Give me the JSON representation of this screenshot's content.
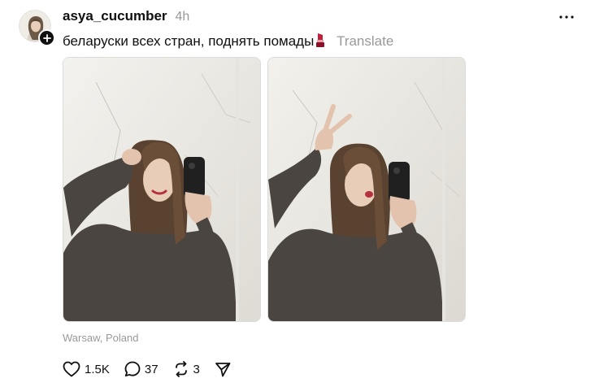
{
  "post": {
    "username": "asya_cucumber",
    "time": "4h",
    "caption": "беларуски всех стран, поднять помады",
    "translate_label": "Translate",
    "location": "Warsaw, Poland",
    "photos": [
      {
        "icon": "photo-selfie-hand-in-hair"
      },
      {
        "icon": "photo-selfie-peace-sign"
      }
    ]
  },
  "actions": {
    "likes": "1.5K",
    "replies": "37",
    "reposts": "3"
  },
  "icons": {
    "follow": "plus-icon",
    "more": "more-dots-icon",
    "caption_emoji": "lipstick-icon",
    "like": "heart-icon",
    "reply": "comment-icon",
    "repost": "repost-icon",
    "share": "send-icon"
  },
  "colors": {
    "text": "#101010",
    "secondary": "#999999",
    "badge": "#101010",
    "lipstick": "#c41e3a"
  }
}
